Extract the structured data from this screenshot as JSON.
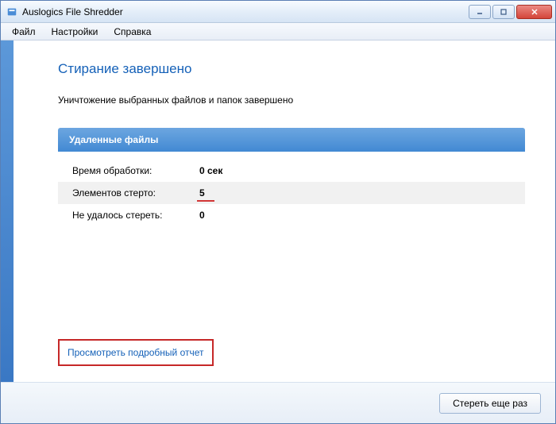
{
  "window": {
    "title": "Auslogics File Shredder"
  },
  "menu": {
    "file": "Файл",
    "settings": "Настройки",
    "help": "Справка"
  },
  "page": {
    "title": "Стирание завершено",
    "subtitle": "Уничтожение выбранных файлов и папок завершено",
    "panel_header": "Удаленные файлы"
  },
  "stats": {
    "rows": [
      {
        "label": "Время обработки:",
        "value": "0 сек",
        "highlight": false
      },
      {
        "label": "Элементов стерто:",
        "value": "5",
        "highlight": true
      },
      {
        "label": "Не удалось стереть:",
        "value": "0",
        "highlight": false
      }
    ]
  },
  "report_link": "Просмотреть подробный отчет",
  "footer": {
    "again_button": "Стереть еще раз"
  }
}
